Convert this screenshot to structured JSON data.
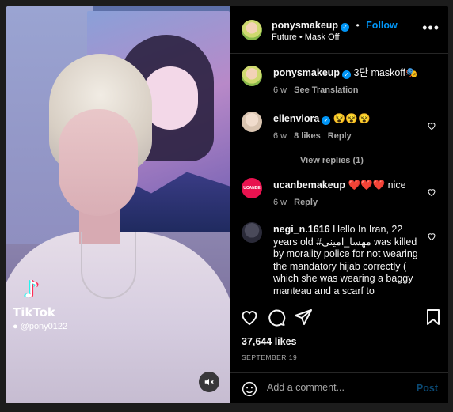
{
  "post": {
    "author": "ponysmakeup",
    "follow_label": "Follow",
    "audio": "Future • Mask Off",
    "caption": {
      "user": "ponysmakeup",
      "text": "3단 maskoff🎭",
      "age": "6 w",
      "translate_label": "See Translation"
    },
    "likes": "37,644 likes",
    "date": "SEPTEMBER 19"
  },
  "media": {
    "tiktok_label": "TikTok",
    "tiktok_handle": "@pony0122"
  },
  "comments": [
    {
      "user": "ellenvlora",
      "verified": true,
      "text": "😵😵😵",
      "age": "6 w",
      "likes": "8 likes",
      "reply": "Reply",
      "view_replies": "View replies (1)"
    },
    {
      "user": "ucanbemakeup",
      "avatar_text": "UCANBE",
      "text": "❤️❤️❤️ nice",
      "age": "6 w",
      "reply": "Reply"
    },
    {
      "user": "negi_n.1616",
      "text": "Hello In Iran, 22 years old #مهسا_امینی was killed by morality police for not wearing the mandatory hijab correctly ( which she was wearing a baggy manteau and a scarf to"
    }
  ],
  "add_comment": {
    "placeholder": "Add a comment...",
    "post_label": "Post"
  },
  "icons": {
    "verified": "verified-icon",
    "more": "more-options-icon",
    "like": "heart-icon",
    "comment": "comment-icon",
    "share": "share-icon",
    "save": "bookmark-icon",
    "emoji": "emoji-icon",
    "mute": "mute-icon"
  },
  "colors": {
    "accent": "#0095f6",
    "background": "#000000",
    "muted_text": "#a8a8a8"
  }
}
